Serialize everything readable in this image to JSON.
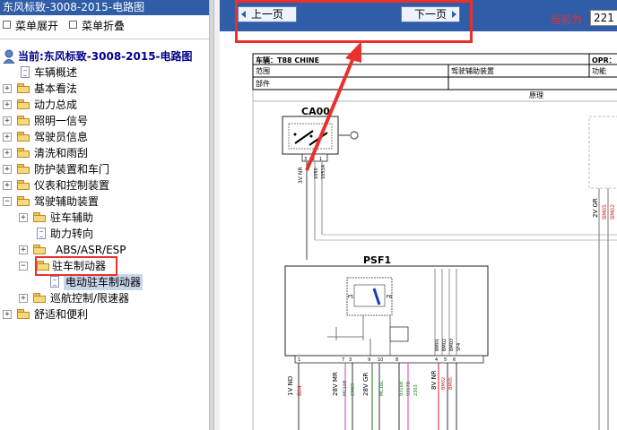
{
  "left_panel": {
    "title": "东风标致-3008-2015-电路图",
    "toolbar": {
      "expand_label": "菜单展开",
      "collapse_label": "菜单折叠"
    },
    "tree": {
      "root_label": "当前:东风标致-3008-2015-电路图",
      "items": [
        {
          "label": "车辆概述"
        },
        {
          "label": "基本看法"
        },
        {
          "label": "动力总成"
        },
        {
          "label": "照明一信号"
        },
        {
          "label": "驾驶员信息"
        },
        {
          "label": "清洗和雨刮"
        },
        {
          "label": "防护装置和车门"
        },
        {
          "label": "仪表和控制装置"
        },
        {
          "label": "驾驶辅助装置"
        },
        {
          "label": "驻车辅助"
        },
        {
          "label": "助力转向"
        },
        {
          "label": "ABS/ASR/ESP"
        },
        {
          "label": "驻车制动器"
        },
        {
          "label": "电动驻车制动器"
        },
        {
          "label": "巡航控制/限速器"
        },
        {
          "label": "舒适和便利"
        }
      ]
    }
  },
  "nav_bar": {
    "prev_label": "上一页",
    "next_label": "下一页",
    "current_label": "当前为",
    "current_value": "221"
  },
  "diagram": {
    "header": {
      "vehicle": "车辆：T88 CHINE",
      "opr": "OPR：",
      "scope": "范围",
      "system": "驾驶辅助装置",
      "function": "功能",
      "component": "部件",
      "principle": "原理"
    },
    "ca00": {
      "name": "CA00",
      "pins": [
        "3",
        "2",
        "1"
      ],
      "wires": [
        "3V NR",
        "1050",
        "1051A"
      ]
    },
    "right_conn": {
      "wire": "2V GR",
      "codes": [
        "BM05",
        "BM02"
      ]
    },
    "psf1": {
      "name": "PSF1",
      "fuse_labels": [
        "F5",
        "F6"
      ],
      "pins": [
        "1",
        "7",
        "3",
        "9",
        "10",
        "8",
        "4",
        "5",
        "6"
      ],
      "side_labels": [
        "BM01",
        "BM02",
        "BM03",
        "SF4"
      ],
      "bottom_wires": [
        {
          "label": "1V ND",
          "code": "B04",
          "code_color": "#cc1f1f"
        },
        {
          "label": "28V MR",
          "code": "MC16B",
          "code2": "CM09",
          "code_color": "#1a7a1a"
        },
        {
          "label": "28V GR",
          "code": "",
          "code_color": "#1a7a1a"
        },
        {
          "label": "MC16C",
          "code": "",
          "code_color": "#1a7a1a"
        },
        {
          "label": "9316B",
          "code": "9317B",
          "code2": "2303",
          "code_color": "#1a7a1a"
        },
        {
          "label": "8V NR",
          "code": "BM02",
          "code2": "BM05",
          "code_color": "#cc1f1f"
        }
      ]
    }
  },
  "colors": {
    "title_bar": "#2f5da8",
    "nav_bar": "#2f5da8",
    "highlight_red": "#e8302d",
    "tree_root": "#00008b"
  }
}
